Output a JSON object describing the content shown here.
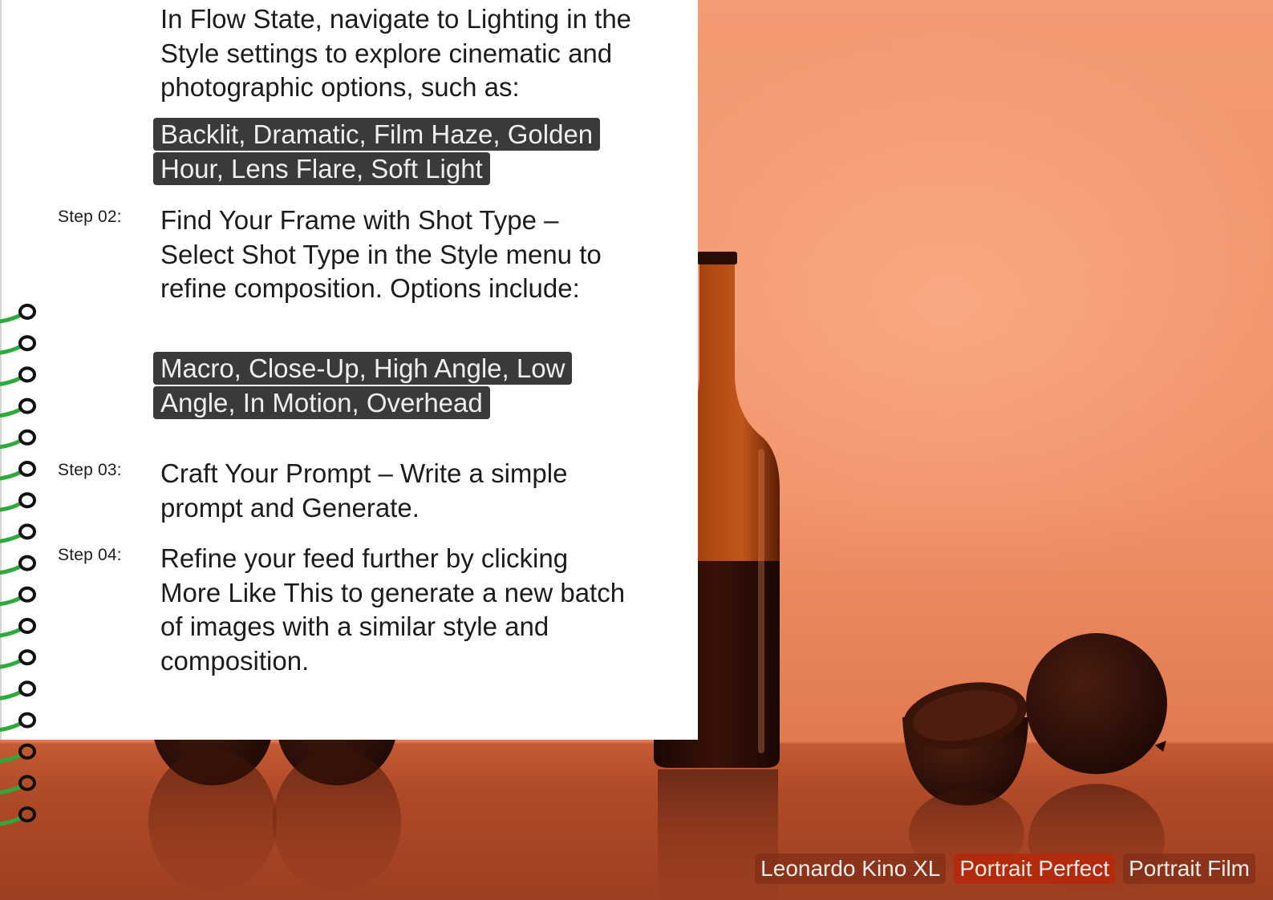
{
  "intro": {
    "text": "In Flow State, navigate to Lighting in the Style settings to explore cinematic and photographic options, such as:",
    "lighting_options": "Backlit, Dramatic, Film Haze, Golden Hour, Lens Flare, Soft Light"
  },
  "steps": [
    {
      "label": "Step 02:",
      "text": "Find Your Frame with Shot Type – Select Shot Type in the Style menu to refine composition. Options include:",
      "options": "Macro, Close-Up, High Angle, Low Angle, In Motion, Overhead"
    },
    {
      "label": "Step 03:",
      "text": "Craft Your Prompt – Write a simple prompt and Generate."
    },
    {
      "label": "Step 04:",
      "text": "Refine your feed further by clicking More Like This to generate a new batch of images with a similar style and composition."
    }
  ],
  "presets": [
    {
      "label": "Leonardo Kino XL"
    },
    {
      "label": "Portrait Perfect"
    },
    {
      "label": "Portrait Film"
    }
  ],
  "colors": {
    "background": "#f09168",
    "tag_background": "#3a3a3a",
    "chip_accent": "#b42a0c",
    "spiral_wire": "#2fa83c"
  }
}
